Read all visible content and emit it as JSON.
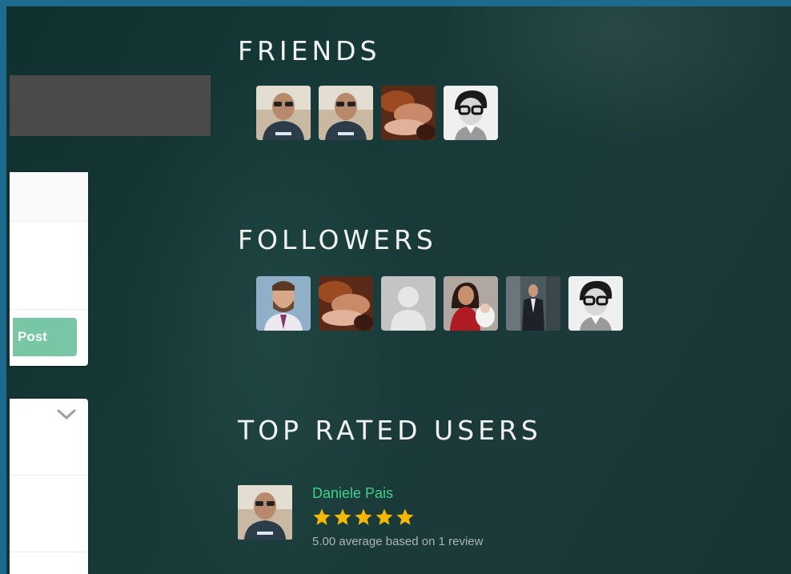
{
  "composer": {
    "post_label": "Post"
  },
  "friends": {
    "title": "FRIENDS",
    "avatars": [
      "bald-man-avatar",
      "bald-man-avatar",
      "hands-photo-avatar",
      "glasses-man-avatar"
    ]
  },
  "followers": {
    "title": "FOLLOWERS",
    "avatars": [
      "bearded-man-avatar",
      "hands-photo-avatar",
      "default-user-avatar",
      "woman-red-dress-avatar",
      "man-suit-avatar",
      "glasses-man-avatar"
    ]
  },
  "top_rated": {
    "title": "TOP RATED USERS",
    "users": [
      {
        "name": "Daniele Pais",
        "rating": 5,
        "max_rating": 5,
        "summary": "5.00 average based on 1 review"
      }
    ]
  },
  "colors": {
    "accent_green": "#3fd08a",
    "post_button": "#77c7a6",
    "star": "#f5b800",
    "frame_border": "#1d6a8f"
  }
}
